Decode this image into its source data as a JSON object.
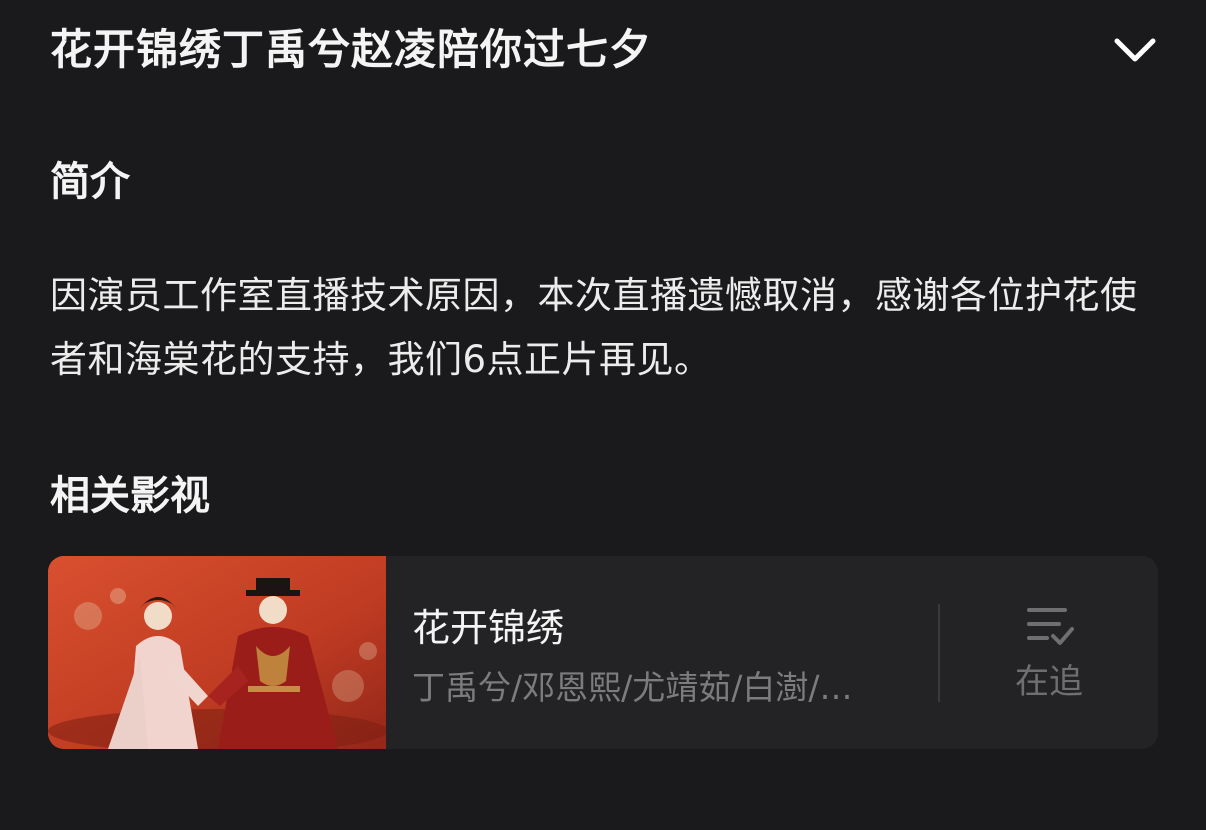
{
  "header": {
    "title": "花开锦绣丁禹兮赵凌陪你过七夕",
    "collapse_icon": "chevron-down-icon"
  },
  "intro": {
    "heading": "简介",
    "text": "因演员工作室直播技术原因，本次直播遗憾取消，感谢各位护花使者和海棠花的支持，我们6点正片再见。"
  },
  "related": {
    "heading": "相关影视",
    "card": {
      "title": "花开锦绣",
      "cast": "丁禹兮/邓恩熙/尤靖茹/白澍/…",
      "follow_label": "在追",
      "follow_icon": "list-check-icon"
    }
  },
  "colors": {
    "background": "#1a1a1c",
    "card_background": "#232325",
    "poster_red": "#c43f24",
    "muted_text": "#7c7c7e"
  }
}
